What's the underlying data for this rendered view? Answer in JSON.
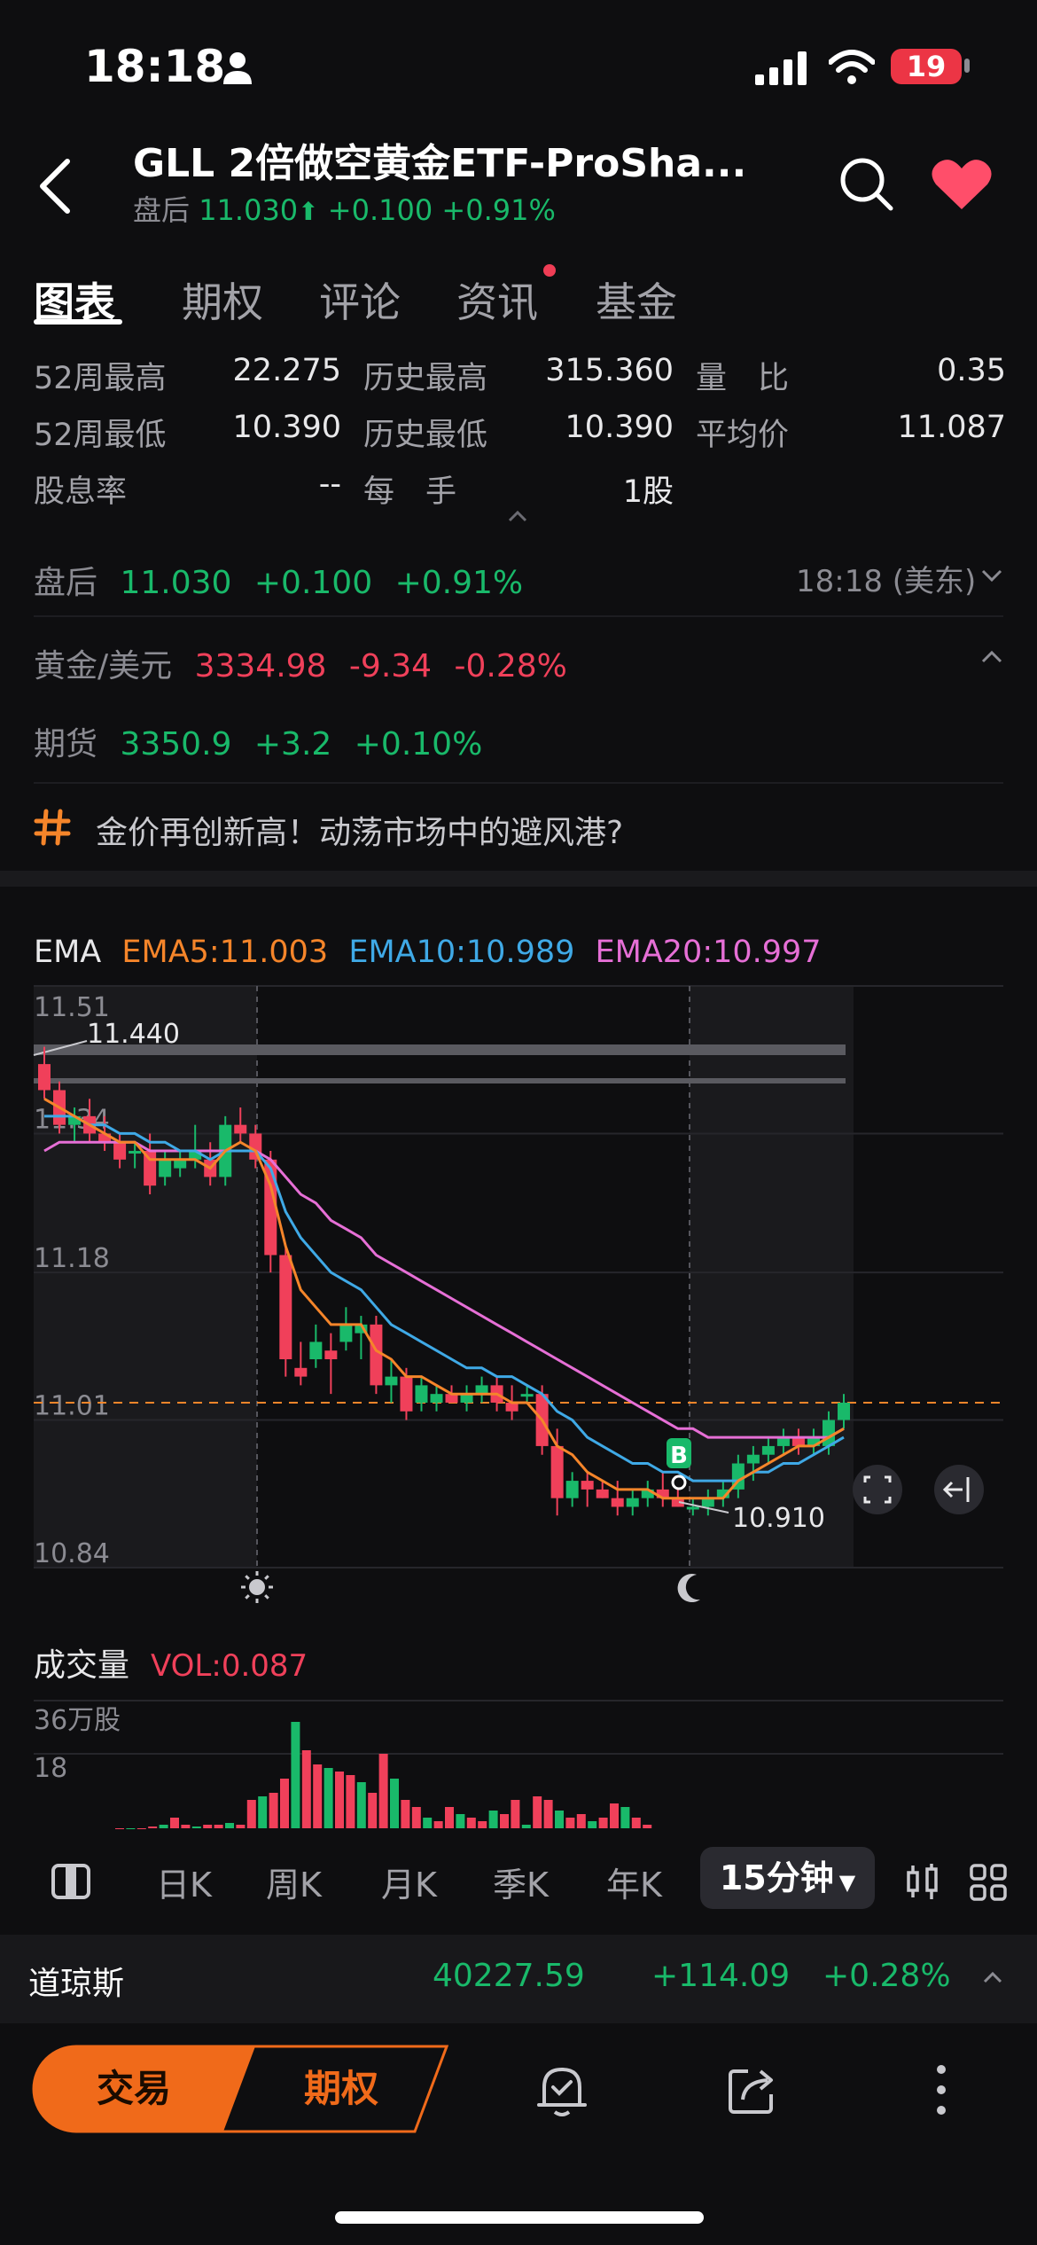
{
  "status_bar": {
    "time": "18:18",
    "battery": "19"
  },
  "header": {
    "title": "GLL  2倍做空黄金ETF-ProSha...",
    "session_label": "盘后",
    "price": "11.030",
    "change": "+0.100",
    "change_pct": "+0.91%"
  },
  "tabs": [
    {
      "label": "图表",
      "active": true
    },
    {
      "label": "期权",
      "active": false
    },
    {
      "label": "评论",
      "active": false
    },
    {
      "label": "资讯",
      "active": false,
      "badge": true
    },
    {
      "label": "基金",
      "active": false
    }
  ],
  "stats": [
    [
      {
        "label": "52周最高",
        "value": "22.275"
      },
      {
        "label": "历史最高",
        "value": "315.360"
      },
      {
        "label": "量　比",
        "value": "0.35"
      }
    ],
    [
      {
        "label": "52周最低",
        "value": "10.390"
      },
      {
        "label": "历史最低",
        "value": "10.390"
      },
      {
        "label": "平均价",
        "value": "11.087"
      }
    ],
    [
      {
        "label": "股息率",
        "value": "--"
      },
      {
        "label": "每　手",
        "value": "1股"
      }
    ]
  ],
  "after_hours": {
    "label": "盘后",
    "price": "11.030",
    "change": "+0.100",
    "change_pct": "+0.91%",
    "time": "18:18 (美东)"
  },
  "gold": {
    "label": "黄金/美元",
    "price": "3334.98",
    "change": "-9.34",
    "change_pct": "-0.28%"
  },
  "futures": {
    "label": "期货",
    "price": "3350.9",
    "change": "+3.2",
    "change_pct": "+0.10%"
  },
  "topic": {
    "text": "金价再创新高！动荡市场中的避风港?"
  },
  "ema_legend": {
    "label": "EMA",
    "ema5": "EMA5:11.003",
    "ema10": "EMA10:10.989",
    "ema20": "EMA20:10.997"
  },
  "colors": {
    "up": "#19b96a",
    "down": "#f0405a",
    "ema5": "#f5852a",
    "ema10": "#3fa9e6",
    "ema20": "#e66fd6",
    "accent": "#f06a1a"
  },
  "chart_data": {
    "type": "candlestick",
    "y_ticks": [
      "11.51",
      "11.34",
      "11.18",
      "11.01",
      "10.84"
    ],
    "ylim": [
      10.84,
      11.51
    ],
    "max_label": "11.440",
    "min_label": "10.910",
    "buy_marker": "B",
    "current_price_line": 11.03,
    "candles": [
      {
        "o": 11.42,
        "h": 11.44,
        "l": 11.38,
        "c": 11.39
      },
      {
        "o": 11.39,
        "h": 11.4,
        "l": 11.34,
        "c": 11.35
      },
      {
        "o": 11.35,
        "h": 11.37,
        "l": 11.33,
        "c": 11.36
      },
      {
        "o": 11.36,
        "h": 11.38,
        "l": 11.33,
        "c": 11.34
      },
      {
        "o": 11.34,
        "h": 11.36,
        "l": 11.32,
        "c": 11.33
      },
      {
        "o": 11.33,
        "h": 11.34,
        "l": 11.3,
        "c": 11.31
      },
      {
        "o": 11.32,
        "h": 11.33,
        "l": 11.3,
        "c": 11.32
      },
      {
        "o": 11.32,
        "h": 11.34,
        "l": 11.27,
        "c": 11.28
      },
      {
        "o": 11.29,
        "h": 11.32,
        "l": 11.28,
        "c": 11.31
      },
      {
        "o": 11.3,
        "h": 11.32,
        "l": 11.29,
        "c": 11.31
      },
      {
        "o": 11.31,
        "h": 11.35,
        "l": 11.3,
        "c": 11.32
      },
      {
        "o": 11.31,
        "h": 11.33,
        "l": 11.28,
        "c": 11.29
      },
      {
        "o": 11.29,
        "h": 11.36,
        "l": 11.28,
        "c": 11.35
      },
      {
        "o": 11.35,
        "h": 11.37,
        "l": 11.33,
        "c": 11.34
      },
      {
        "o": 11.34,
        "h": 11.35,
        "l": 11.3,
        "c": 11.31
      },
      {
        "o": 11.31,
        "h": 11.32,
        "l": 11.18,
        "c": 11.2
      },
      {
        "o": 11.2,
        "h": 11.21,
        "l": 11.06,
        "c": 11.08
      },
      {
        "o": 11.07,
        "h": 11.1,
        "l": 11.05,
        "c": 11.06
      },
      {
        "o": 11.08,
        "h": 11.12,
        "l": 11.07,
        "c": 11.1
      },
      {
        "o": 11.09,
        "h": 11.11,
        "l": 11.04,
        "c": 11.08
      },
      {
        "o": 11.1,
        "h": 11.14,
        "l": 11.09,
        "c": 11.12
      },
      {
        "o": 11.11,
        "h": 11.13,
        "l": 11.08,
        "c": 11.12
      },
      {
        "o": 11.12,
        "h": 11.13,
        "l": 11.04,
        "c": 11.05
      },
      {
        "o": 11.05,
        "h": 11.08,
        "l": 11.03,
        "c": 11.06
      },
      {
        "o": 11.06,
        "h": 11.07,
        "l": 11.01,
        "c": 11.02
      },
      {
        "o": 11.03,
        "h": 11.06,
        "l": 11.02,
        "c": 11.05
      },
      {
        "o": 11.03,
        "h": 11.05,
        "l": 11.02,
        "c": 11.04
      },
      {
        "o": 11.04,
        "h": 11.05,
        "l": 11.03,
        "c": 11.03
      },
      {
        "o": 11.03,
        "h": 11.05,
        "l": 11.02,
        "c": 11.04
      },
      {
        "o": 11.04,
        "h": 11.06,
        "l": 11.03,
        "c": 11.05
      },
      {
        "o": 11.05,
        "h": 11.06,
        "l": 11.02,
        "c": 11.03
      },
      {
        "o": 11.03,
        "h": 11.05,
        "l": 11.01,
        "c": 11.02
      },
      {
        "o": 11.04,
        "h": 11.05,
        "l": 11.03,
        "c": 11.04
      },
      {
        "o": 11.04,
        "h": 11.05,
        "l": 10.97,
        "c": 10.98
      },
      {
        "o": 10.98,
        "h": 11.0,
        "l": 10.9,
        "c": 10.92
      },
      {
        "o": 10.92,
        "h": 10.95,
        "l": 10.91,
        "c": 10.94
      },
      {
        "o": 10.94,
        "h": 10.95,
        "l": 10.91,
        "c": 10.93
      },
      {
        "o": 10.93,
        "h": 10.94,
        "l": 10.92,
        "c": 10.92
      },
      {
        "o": 10.92,
        "h": 10.94,
        "l": 10.9,
        "c": 10.91
      },
      {
        "o": 10.91,
        "h": 10.93,
        "l": 10.9,
        "c": 10.92
      },
      {
        "o": 10.92,
        "h": 10.94,
        "l": 10.91,
        "c": 10.93
      },
      {
        "o": 10.93,
        "h": 10.95,
        "l": 10.91,
        "c": 10.92
      },
      {
        "o": 10.92,
        "h": 10.94,
        "l": 10.91,
        "c": 10.91
      },
      {
        "o": 10.91,
        "h": 10.92,
        "l": 10.9,
        "c": 10.91
      },
      {
        "o": 10.91,
        "h": 10.93,
        "l": 10.9,
        "c": 10.92
      },
      {
        "o": 10.92,
        "h": 10.94,
        "l": 10.91,
        "c": 10.93
      },
      {
        "o": 10.93,
        "h": 10.97,
        "l": 10.92,
        "c": 10.96
      },
      {
        "o": 10.96,
        "h": 10.98,
        "l": 10.94,
        "c": 10.97
      },
      {
        "o": 10.97,
        "h": 10.99,
        "l": 10.96,
        "c": 10.98
      },
      {
        "o": 10.98,
        "h": 11.0,
        "l": 10.97,
        "c": 10.99
      },
      {
        "o": 10.99,
        "h": 11.0,
        "l": 10.97,
        "c": 10.98
      },
      {
        "o": 10.98,
        "h": 11.0,
        "l": 10.97,
        "c": 10.99
      },
      {
        "o": 10.98,
        "h": 11.02,
        "l": 10.97,
        "c": 11.01
      },
      {
        "o": 11.01,
        "h": 11.04,
        "l": 11.0,
        "c": 11.03
      }
    ],
    "ema5": [
      11.38,
      11.37,
      11.36,
      11.35,
      11.34,
      11.33,
      11.33,
      11.31,
      11.31,
      11.31,
      11.31,
      11.3,
      11.32,
      11.33,
      11.32,
      11.28,
      11.21,
      11.16,
      11.14,
      11.12,
      11.12,
      11.12,
      11.09,
      11.08,
      11.06,
      11.06,
      11.05,
      11.04,
      11.04,
      11.04,
      11.04,
      11.03,
      11.03,
      11.01,
      10.98,
      10.97,
      10.95,
      10.94,
      10.93,
      10.93,
      10.93,
      10.92,
      10.92,
      10.92,
      10.92,
      10.92,
      10.94,
      10.95,
      10.96,
      10.97,
      10.98,
      10.98,
      10.99,
      11.0
    ],
    "ema10": [
      11.36,
      11.36,
      11.36,
      11.35,
      11.35,
      11.34,
      11.34,
      11.33,
      11.33,
      11.32,
      11.32,
      11.31,
      11.32,
      11.32,
      11.32,
      11.3,
      11.25,
      11.22,
      11.2,
      11.18,
      11.17,
      11.16,
      11.14,
      11.12,
      11.11,
      11.1,
      11.09,
      11.08,
      11.07,
      11.07,
      11.06,
      11.06,
      11.05,
      11.04,
      11.02,
      11.01,
      10.99,
      10.98,
      10.97,
      10.96,
      10.96,
      10.95,
      10.95,
      10.94,
      10.94,
      10.94,
      10.94,
      10.95,
      10.95,
      10.96,
      10.96,
      10.97,
      10.98,
      10.99
    ],
    "ema20": [
      11.32,
      11.33,
      11.33,
      11.33,
      11.33,
      11.33,
      11.33,
      11.32,
      11.32,
      11.32,
      11.32,
      11.32,
      11.32,
      11.32,
      11.32,
      11.31,
      11.29,
      11.27,
      11.26,
      11.24,
      11.23,
      11.22,
      11.2,
      11.19,
      11.18,
      11.17,
      11.16,
      11.15,
      11.14,
      11.13,
      11.12,
      11.11,
      11.1,
      11.09,
      11.08,
      11.07,
      11.06,
      11.05,
      11.04,
      11.03,
      11.02,
      11.01,
      11.0,
      11.0,
      10.99,
      10.99,
      10.99,
      10.99,
      10.99,
      10.99,
      10.99,
      10.99,
      10.99,
      11.0
    ],
    "volume_label": "成交量",
    "volume_value": "VOL:0.087",
    "volume_ticks": [
      "36万股",
      "18"
    ],
    "volume": [
      0,
      0,
      0,
      0.5,
      1,
      3,
      1,
      0.5,
      1,
      1,
      1.5,
      1,
      8,
      9,
      10,
      14,
      30,
      22,
      18,
      17,
      16,
      15,
      13,
      10,
      21,
      14,
      8,
      6,
      3,
      2,
      6,
      4,
      3,
      2,
      5,
      4,
      8,
      1,
      9,
      8,
      5,
      3,
      4,
      2,
      3,
      7,
      6,
      3,
      1
    ]
  },
  "kline_tabs": [
    "日K",
    "周K",
    "月K",
    "季K",
    "年K"
  ],
  "kline_active": "15分钟",
  "index": {
    "name": "道琼斯",
    "value": "40227.59",
    "change": "+114.09",
    "change_pct": "+0.28%"
  },
  "bottom": {
    "trade": "交易",
    "options": "期权"
  }
}
